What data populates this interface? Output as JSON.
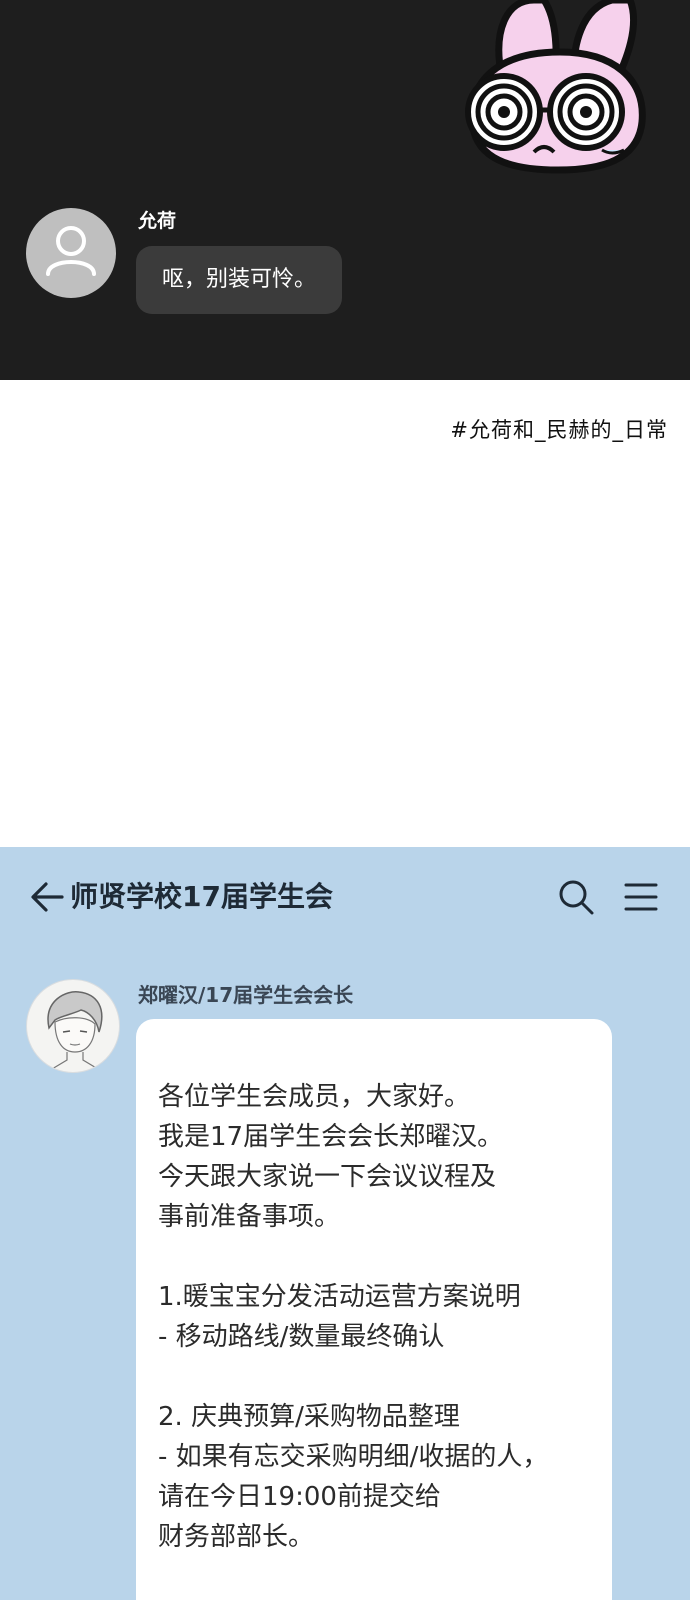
{
  "dark_chat": {
    "sticker_icon": "dizzy-bunny-sticker",
    "avatar_icon": "default-user-icon",
    "sender": "允荷",
    "message": "呕，别装可怜。",
    "colors": {
      "background": "#1e1e1e",
      "bubble": "#3b3b3b",
      "text": "#ffffff"
    }
  },
  "hashtag": "#允荷和_民赫的_日常",
  "group_chat": {
    "header": {
      "back_icon": "arrow-left-icon",
      "title": "师贤学校17届学生会",
      "search_icon": "search-icon",
      "menu_icon": "hamburger-menu-icon"
    },
    "message": {
      "avatar_icon": "user-avatar-illustration",
      "sender": "郑曜汉/17届学生会会长",
      "lines": [
        "各位学生会成员，大家好。",
        "我是17届学生会会长郑曜汉。",
        "今天跟大家说一下会议议程及",
        "事前准备事项。",
        "",
        "1.暖宝宝分发活动运营方案说明",
        "- 移动路线/数量最终确认",
        "",
        "2. 庆典预算/采购物品整理",
        "- 如果有忘交采购明细/收据的人，",
        "请在今日19:00前提交给",
        "财务部部长。"
      ]
    },
    "colors": {
      "background": "#b9d4ea",
      "bubble": "#ffffff",
      "title": "#1e2a36"
    }
  }
}
